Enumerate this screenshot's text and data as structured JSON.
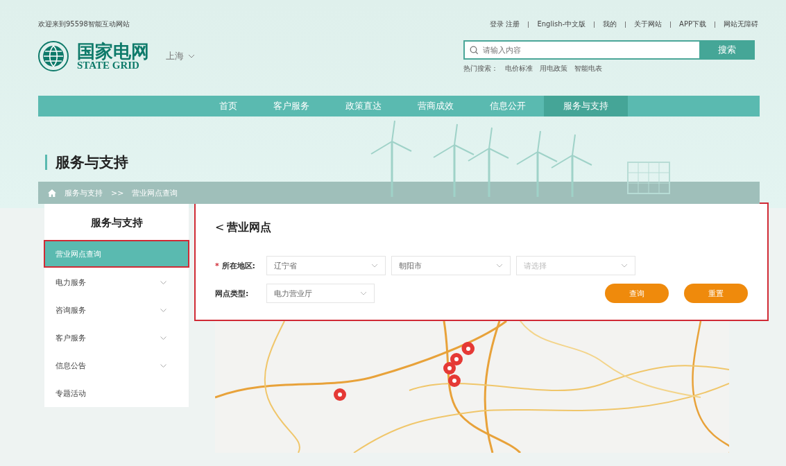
{
  "top_bar": {
    "welcome": "欢迎来到95598智能互动网站",
    "links": [
      {
        "label": "登录 注册"
      },
      {
        "label": "English-中文版"
      },
      {
        "label": "我的"
      },
      {
        "label": "关于网站"
      },
      {
        "label": "APP下载"
      },
      {
        "label": "网站无障碍"
      }
    ]
  },
  "header": {
    "logo_cn": "国家电网",
    "logo_en": "STATE GRID",
    "city": "上海",
    "search": {
      "placeholder": "请输入内容",
      "button": "搜索"
    },
    "hot_label": "热门搜索：",
    "hot": [
      "电价标准",
      "用电政策",
      "智能电表"
    ]
  },
  "nav": [
    {
      "label": "首页",
      "selected": false
    },
    {
      "label": "客户服务",
      "selected": false
    },
    {
      "label": "政策直达",
      "selected": false
    },
    {
      "label": "营商成效",
      "selected": false
    },
    {
      "label": "信息公开",
      "selected": false
    },
    {
      "label": "服务与支持",
      "selected": true
    }
  ],
  "banner": {
    "title": "服务与支持",
    "breadcrumb": [
      "服务与支持",
      "营业网点查询"
    ],
    "separator": ">>"
  },
  "sidebar": {
    "title": "服务与支持",
    "items": [
      {
        "label": "营业网点查询",
        "selected": true,
        "expandable": false
      },
      {
        "label": "电力服务",
        "selected": false,
        "expandable": true
      },
      {
        "label": "咨询服务",
        "selected": false,
        "expandable": true
      },
      {
        "label": "客户服务",
        "selected": false,
        "expandable": true
      },
      {
        "label": "信息公告",
        "selected": false,
        "expandable": true
      },
      {
        "label": "专题活动",
        "selected": false,
        "expandable": false
      }
    ]
  },
  "panel": {
    "back": "<",
    "title": "营业网点",
    "region": {
      "required": "*",
      "label": "所在地区:",
      "selects": [
        {
          "value": "辽宁省"
        },
        {
          "value": "朝阳市"
        },
        {
          "placeholder": "请选择"
        }
      ]
    },
    "type": {
      "label": "网点类型:",
      "select": {
        "value": "电力营业厅"
      }
    },
    "buttons": [
      "查询",
      "重置"
    ]
  }
}
